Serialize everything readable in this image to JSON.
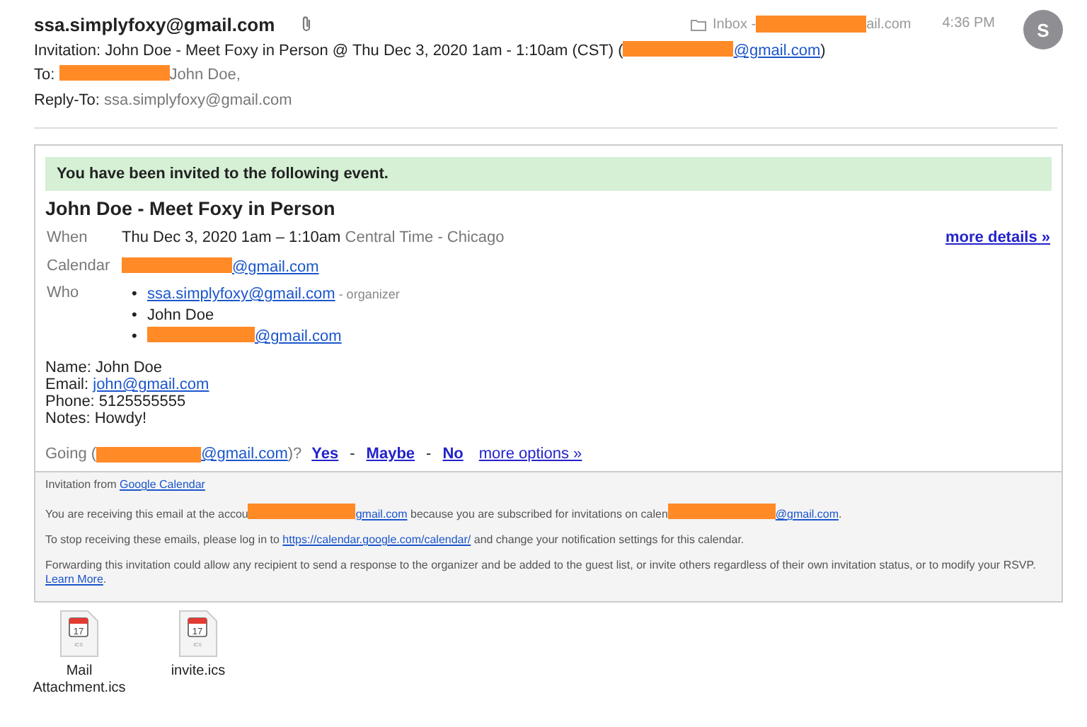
{
  "header": {
    "sender": "ssa.simplyfoxy@gmail.com",
    "mailbox": [
      {
        "kind": "text",
        "text": "Inbox -"
      },
      {
        "kind": "redaction"
      },
      {
        "kind": "text",
        "text": "ail.com"
      }
    ],
    "time": "4:36 PM",
    "avatar": "S",
    "subject": [
      {
        "kind": "text",
        "text": "Invitation: John Doe - Meet Foxy in Person @ Thu Dec 3, 2020 1am - 1:10am (CST) ("
      },
      {
        "kind": "redaction"
      },
      {
        "kind": "link",
        "text": "@gmail.com"
      },
      {
        "kind": "text",
        "text": ")"
      }
    ],
    "to_label": "To:",
    "to": [
      {
        "kind": "redaction"
      },
      {
        "kind": "muted",
        "text": "John Doe,"
      }
    ],
    "reply_to_label": "Reply-To:",
    "reply_to": "ssa.simplyfoxy@gmail.com"
  },
  "invite": {
    "banner": "You have been invited to the following event.",
    "title": "John Doe - Meet Foxy in Person",
    "when_label": "When",
    "when": "Thu Dec 3, 2020 1am – 1:10am",
    "timezone": "Central Time - Chicago",
    "more_details": "more details »",
    "calendar_label": "Calendar",
    "calendar": [
      {
        "kind": "redaction"
      },
      {
        "kind": "link",
        "text": "@gmail.com"
      }
    ],
    "who_label": "Who",
    "bullet": "•",
    "who": [
      [
        {
          "kind": "link",
          "text": "ssa.simplyfoxy@gmail.com"
        },
        {
          "kind": "small",
          "text": "- organizer"
        }
      ],
      [
        {
          "kind": "text",
          "text": "John Doe"
        }
      ],
      [
        {
          "kind": "redaction"
        },
        {
          "kind": "link",
          "text": "@gmail.com"
        }
      ]
    ],
    "notes": [
      [
        {
          "kind": "text",
          "text": "Name: John Doe"
        }
      ],
      [
        {
          "kind": "text",
          "text": "Email: "
        },
        {
          "kind": "link",
          "text": "john@gmail.com"
        }
      ],
      [
        {
          "kind": "text",
          "text": "Phone: 5125555555"
        }
      ],
      [
        {
          "kind": "text",
          "text": "Notes: Howdy!"
        }
      ]
    ],
    "going": [
      {
        "kind": "muted",
        "text": "Going ("
      },
      {
        "kind": "redaction"
      },
      {
        "kind": "link",
        "text": "@gmail.com"
      },
      {
        "kind": "muted",
        "text": ")?"
      }
    ],
    "rsvp": [
      "Yes",
      "Maybe",
      "No"
    ],
    "rsvp_separator": "-",
    "more_options": "more options »"
  },
  "footer": [
    [
      {
        "kind": "text",
        "text": "Invitation from "
      },
      {
        "kind": "link",
        "text": "Google Calendar"
      }
    ],
    [
      {
        "kind": "text",
        "text": "You are receiving this email at the accou"
      },
      {
        "kind": "redaction"
      },
      {
        "kind": "link",
        "text": "gmail.com"
      },
      {
        "kind": "text",
        "text": " because you are subscribed for invitations on calen"
      },
      {
        "kind": "redaction"
      },
      {
        "kind": "link",
        "text": "@gmail.com"
      },
      {
        "kind": "text",
        "text": "."
      }
    ],
    [
      {
        "kind": "text",
        "text": "To stop receiving these emails, please log in to "
      },
      {
        "kind": "link",
        "text": "https://calendar.google.com/calendar/"
      },
      {
        "kind": "text",
        "text": " and change your notification settings for this calendar."
      }
    ],
    [
      {
        "kind": "text",
        "text": "Forwarding this invitation could allow any recipient to send a response to the organizer and be added to the guest list, or invite others regardless of their own invitation status, or to modify your RSVP. "
      },
      {
        "kind": "link",
        "text": "Learn More"
      },
      {
        "kind": "text",
        "text": "."
      }
    ]
  ],
  "attachments": [
    {
      "name": "Mail Attachment.ics",
      "day": "17",
      "ext": "ICS"
    },
    {
      "name": "invite.ics",
      "day": "17",
      "ext": "ICS"
    }
  ]
}
